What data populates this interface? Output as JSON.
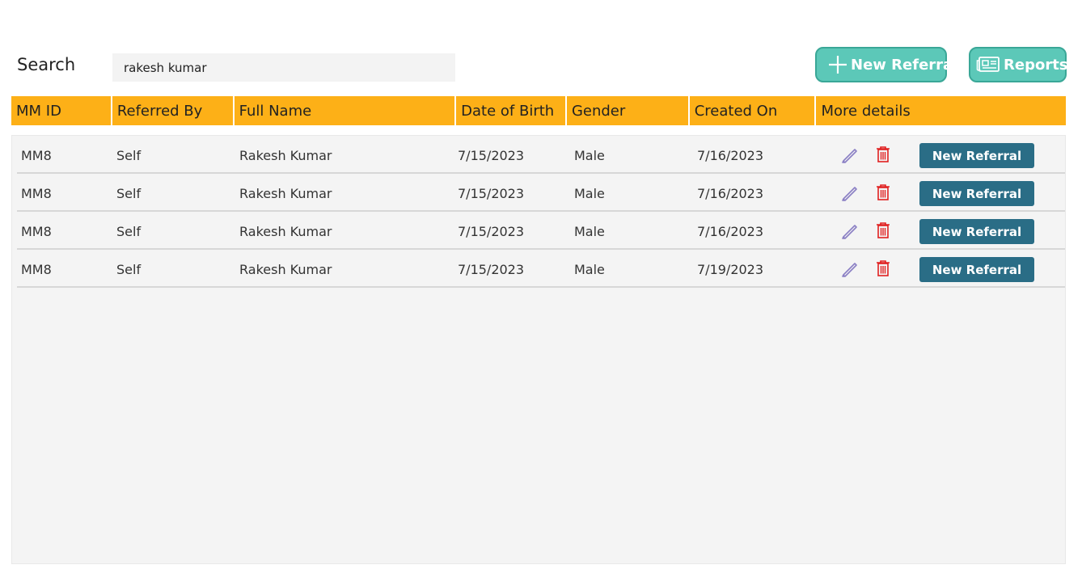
{
  "search": {
    "label": "Search",
    "value": "rakesh kumar"
  },
  "toolbar": {
    "new_referral_label": "New Referral",
    "new_referral_icon": "plus-icon",
    "reports_label": "Reports",
    "reports_icon": "newspaper-icon"
  },
  "table": {
    "columns": [
      "MM ID",
      "Referred By",
      "Full Name",
      "Date of Birth",
      "Gender",
      "Created On",
      "More details"
    ],
    "rows": [
      {
        "mm_id": "MM8",
        "referred_by": "Self",
        "full_name": "Rakesh Kumar",
        "dob": "7/15/2023",
        "gender": "Male",
        "created_on": "7/16/2023",
        "action_label": "New Referral"
      },
      {
        "mm_id": "MM8",
        "referred_by": "Self",
        "full_name": "Rakesh Kumar",
        "dob": "7/15/2023",
        "gender": "Male",
        "created_on": "7/16/2023",
        "action_label": "New Referral"
      },
      {
        "mm_id": "MM8",
        "referred_by": "Self",
        "full_name": "Rakesh Kumar",
        "dob": "7/15/2023",
        "gender": "Male",
        "created_on": "7/16/2023",
        "action_label": "New Referral"
      },
      {
        "mm_id": "MM8",
        "referred_by": "Self",
        "full_name": "Rakesh Kumar",
        "dob": "7/15/2023",
        "gender": "Male",
        "created_on": "7/19/2023",
        "action_label": "New Referral"
      }
    ]
  },
  "colors": {
    "header_bg": "#fdb017",
    "accent_teal": "#5cc8b8",
    "row_button": "#2a6d86",
    "edit_icon": "#8a7fc4",
    "delete_icon": "#e02020"
  }
}
